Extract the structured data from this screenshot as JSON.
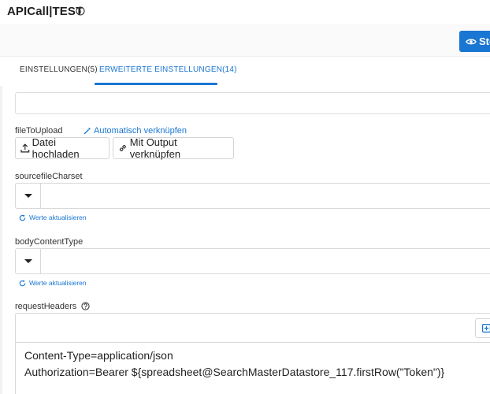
{
  "header": {
    "title": "APICall|TEST",
    "info_icon": "info-circle-icon",
    "view_button_label": "Ste"
  },
  "tabs": [
    {
      "label": "EINSTELLUNGEN(5)",
      "active": false
    },
    {
      "label": "ERWEITERTE EINSTELLUNGEN(14)",
      "active": true
    }
  ],
  "fields": {
    "file_to_upload": {
      "label": "fileToUpload",
      "auto_link_label": "Automatisch verknüpfen",
      "upload_button_label": "Datei hochladen",
      "output_button_label": "Mit Output verknüpfen"
    },
    "source_file_charset": {
      "label": "sourcefileCharset",
      "value": "",
      "refresh_label": "Werte aktualisieren"
    },
    "body_content_type": {
      "label": "bodyContentType",
      "value": "",
      "refresh_label": "Werte aktualisieren"
    },
    "request_headers": {
      "label": "requestHeaders",
      "lines": [
        "Content-Type=application/json",
        "Authorization=Bearer ${spreadsheet@SearchMasterDatastore_117.firstRow(\"Token\")}"
      ]
    }
  },
  "colors": {
    "accent": "#1976d2",
    "border": "#d8d8d8",
    "text": "#222222"
  }
}
